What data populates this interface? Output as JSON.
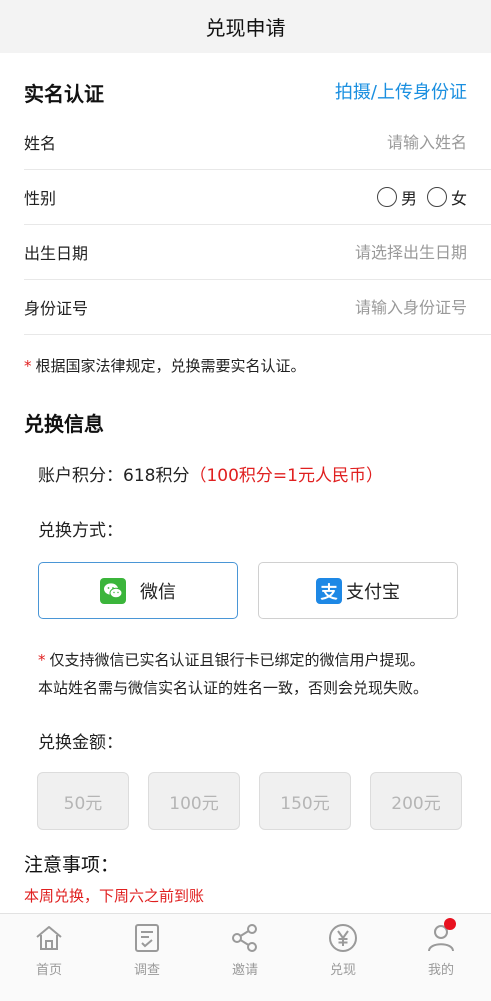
{
  "header": {
    "title": "兑现申请"
  },
  "realname": {
    "title": "实名认证",
    "upload_link": "拍摄/上传身份证",
    "name": {
      "label": "姓名",
      "placeholder": "请输入姓名"
    },
    "gender": {
      "label": "性别",
      "male": "男",
      "female": "女"
    },
    "birth": {
      "label": "出生日期",
      "placeholder": "请选择出生日期"
    },
    "id_number": {
      "label": "身份证号",
      "placeholder": "请输入身份证号"
    },
    "note": "根据国家法律规定，兑换需要实名认证。"
  },
  "exchange": {
    "title": "兑换信息",
    "points_label": "账户积分：618积分",
    "points_rate": "（100积分=1元人民币）",
    "method_label": "兑换方式：",
    "methods": [
      {
        "label": "微信",
        "icon": "wechat-icon",
        "selected": true
      },
      {
        "label": "支付宝",
        "icon": "alipay-icon",
        "selected": false
      }
    ],
    "note_line1": "仅支持微信已实名认证且银行卡已绑定的微信用户提现。",
    "note_line2": "本站姓名需与微信实名认证的姓名一致，否则会兑现失败。",
    "amount_label": "兑换金额：",
    "amounts": [
      "50元",
      "100元",
      "150元",
      "200元"
    ]
  },
  "notice": {
    "title": "注意事项：",
    "text": "本周兑换，下周六之前到账"
  },
  "tabbar": {
    "items": [
      {
        "label": "首页",
        "icon": "home-icon"
      },
      {
        "label": "调查",
        "icon": "survey-icon"
      },
      {
        "label": "邀请",
        "icon": "share-icon"
      },
      {
        "label": "兑现",
        "icon": "yen-icon"
      },
      {
        "label": "我的",
        "icon": "profile-icon"
      }
    ]
  },
  "colors": {
    "accent": "#1a8fe0",
    "warning": "#e02020",
    "wechat": "#3bb53b",
    "alipay": "#1e88e5",
    "badge": "#e8111f"
  }
}
